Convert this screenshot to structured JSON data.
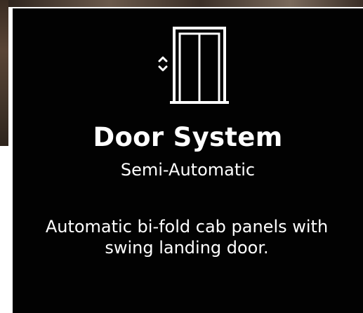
{
  "card": {
    "icon": "elevator-door-icon",
    "title": "Door System",
    "subtitle": "Semi-Automatic",
    "description": "Automatic bi-fold cab panels with swing landing door."
  },
  "colors": {
    "card_background": "#020202",
    "text": "#ffffff"
  }
}
